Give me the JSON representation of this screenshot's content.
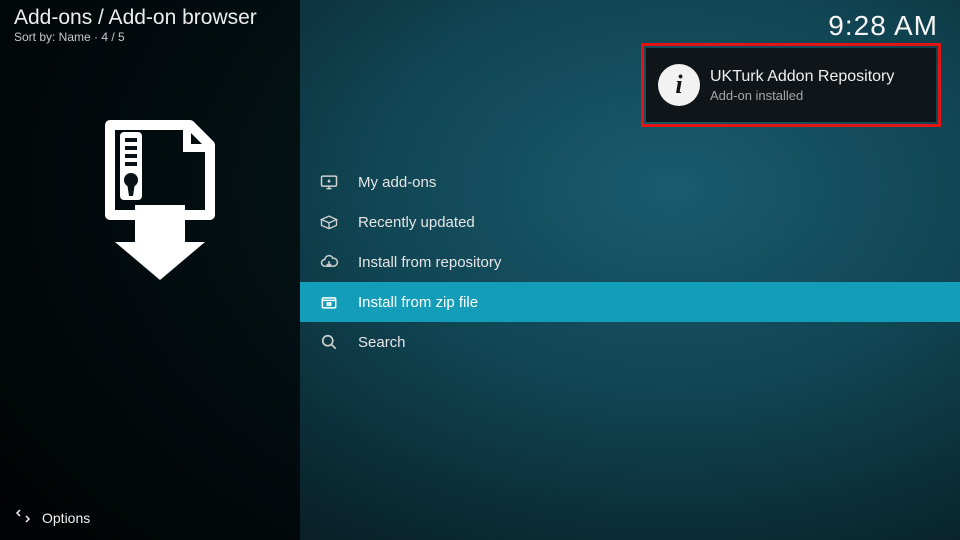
{
  "breadcrumb": "Add-ons / Add-on browser",
  "sort_line": "Sort by: Name  ·  4 / 5",
  "clock": "9:28 AM",
  "menu": {
    "items": [
      {
        "label": "My add-ons",
        "icon": "monitor",
        "selected": false
      },
      {
        "label": "Recently updated",
        "icon": "box-open",
        "selected": false
      },
      {
        "label": "Install from repository",
        "icon": "cloud-download",
        "selected": false
      },
      {
        "label": "Install from zip file",
        "icon": "zip-file",
        "selected": true
      },
      {
        "label": "Search",
        "icon": "search",
        "selected": false
      }
    ]
  },
  "toast": {
    "title": "UKTurk Addon Repository",
    "subtitle": "Add-on installed",
    "icon": "info"
  },
  "options_label": "Options",
  "colors": {
    "accent": "#149db8",
    "toast_outline": "#e31414"
  }
}
